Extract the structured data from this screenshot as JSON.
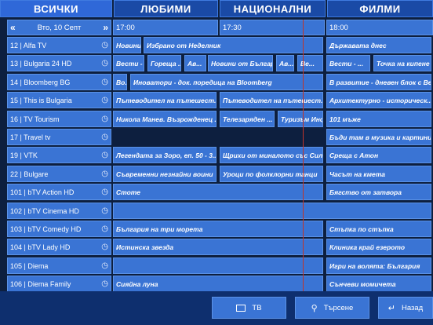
{
  "tabs": [
    {
      "label": "ВСИЧКИ",
      "active": true
    },
    {
      "label": "ЛЮБИМИ",
      "active": false
    },
    {
      "label": "НАЦИОНАЛНИ",
      "active": false
    },
    {
      "label": "ФИЛМИ",
      "active": false
    }
  ],
  "date_nav": {
    "label": "Втo, 10 Септ",
    "prev_icon": "chevron-left-icon",
    "next_icon": "chevron-right-icon"
  },
  "time_headers": [
    "17:00",
    "17:30",
    "18:00"
  ],
  "channels": [
    {
      "name": "12 | Alfa TV",
      "programs": [
        "Новини",
        "Избрано от Неделник",
        "",
        "Държавата днес"
      ]
    },
    {
      "name": "13 | Bulgaria 24 HD",
      "programs": [
        "Вести - ...",
        "Гореща ...",
        "Ав...",
        "Новини от Българ...",
        "Ав...",
        "Ве...",
        "Вести - ...",
        "Точка на кипене"
      ]
    },
    {
      "name": "14 | Bloomberg BG",
      "programs": [
        "Во...",
        "Иноватори - док. поредица на Bloomberg",
        "В развитие - дневен блок с Ве"
      ]
    },
    {
      "name": "15 | This is Bulgaria",
      "programs": [
        "Пътеводител на пътешест...",
        "Пътеводител на пътешест...",
        "Архитектурно - историческ..."
      ]
    },
    {
      "name": "16 | TV Tourism",
      "programs": [
        "Никола Манев. Възрожденец ...",
        "Телезаряден ...",
        "Туризъм Инфо",
        "101 мъже"
      ]
    },
    {
      "name": "17 | Travel tv",
      "programs": [
        "Бъди там в музика и картини"
      ]
    },
    {
      "name": "19 | VTK",
      "programs": [
        "Легендата за Зоро, еп. 50 - 3...",
        "Щрихи от миналото със Сил...",
        "Среща с Атон"
      ]
    },
    {
      "name": "22 | Bulgare",
      "programs": [
        "Съвременни незнайни воини",
        "Уроци по фолклорни танци",
        "Часът на кмета"
      ]
    },
    {
      "name": "101 | bTV Action HD",
      "programs": [
        "Стоте",
        "Бягство от затвора"
      ]
    },
    {
      "name": "102 | bTV Cinema HD",
      "programs": [
        ""
      ]
    },
    {
      "name": "103 | bTV Comedy HD",
      "programs": [
        "България на три морета",
        "Стъпка по стъпка"
      ]
    },
    {
      "name": "104 | bTV Lady HD",
      "programs": [
        "Истинска звезда",
        "Клиника край езерото"
      ]
    },
    {
      "name": "105 | Diema",
      "programs": [
        "",
        "Игри на волята: България"
      ]
    },
    {
      "name": "106 | Diema Family",
      "programs": [
        "Сияйна луна",
        "Сънчеви момичета"
      ]
    }
  ],
  "buttons": {
    "tv": {
      "label": "ТВ",
      "icon": "tv-icon"
    },
    "search": {
      "label": "Търсене",
      "icon": "search-icon"
    },
    "back": {
      "label": "Назад",
      "icon": "back-arrow-icon"
    }
  },
  "colors": {
    "accent": "#3a74d4",
    "background": "#0d1f3f",
    "now_line": "#c0352a"
  }
}
